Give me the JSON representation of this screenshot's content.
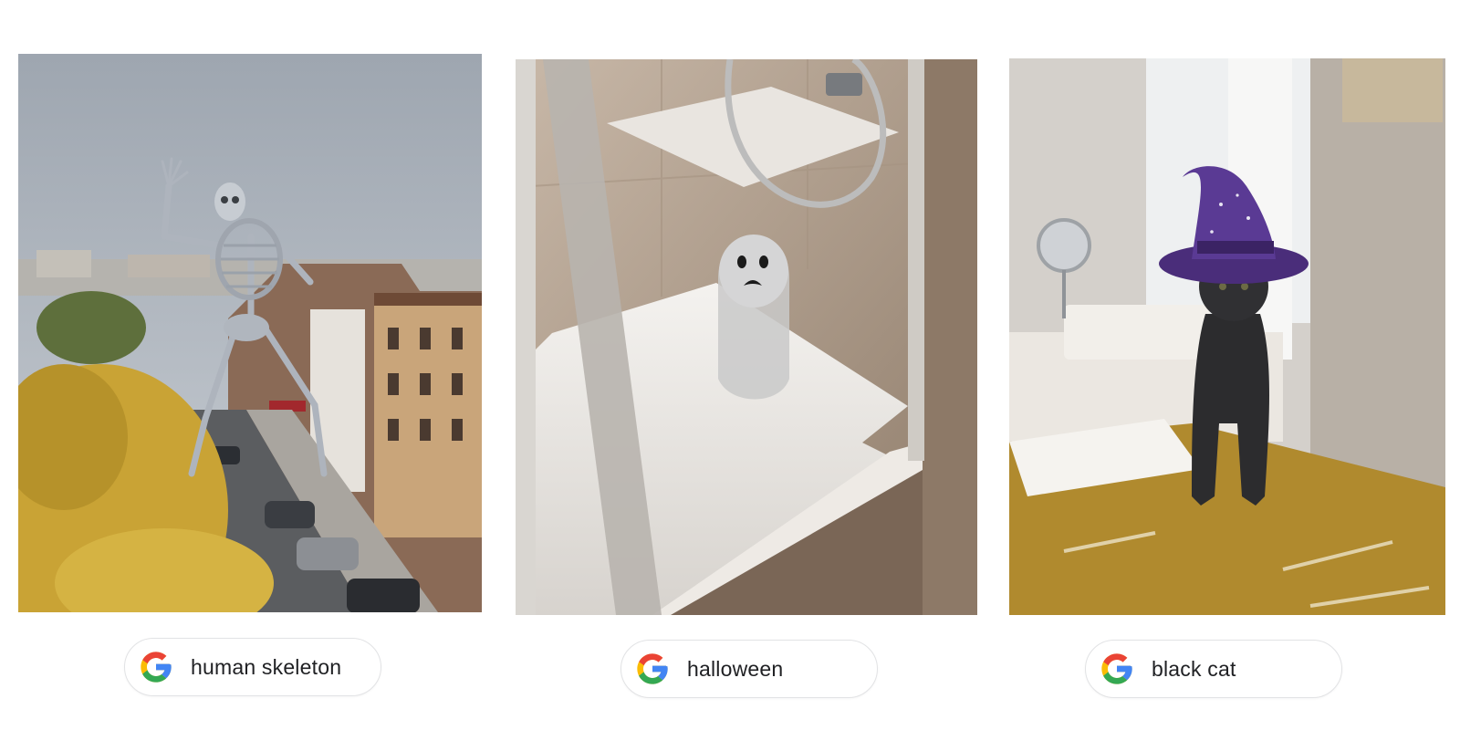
{
  "cards": [
    {
      "query": "human skeleton",
      "image_subject": "skeleton-ar-street"
    },
    {
      "query": "halloween",
      "image_subject": "ghost-ar-shower"
    },
    {
      "query": "black cat",
      "image_subject": "cat-witch-hat-ar-bedroom"
    }
  ],
  "brand": {
    "logo": "google-g-icon",
    "colors": {
      "blue": "#4285F4",
      "red": "#EA4335",
      "yellow": "#FBBC05",
      "green": "#34A853"
    }
  }
}
